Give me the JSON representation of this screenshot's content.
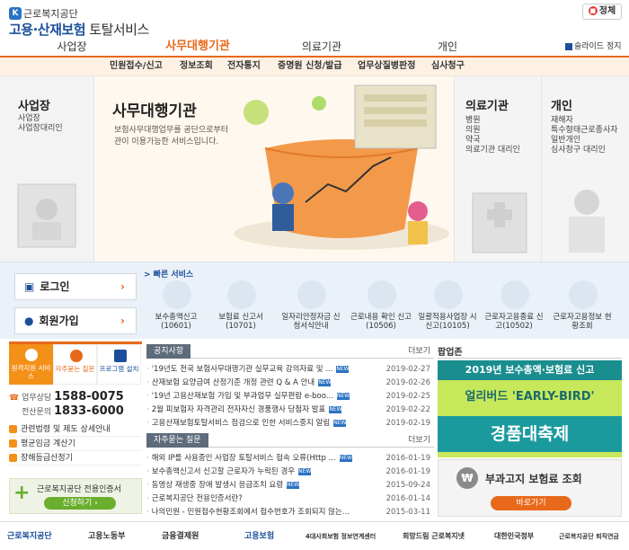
{
  "header": {
    "logo_mark": "K",
    "org_small": "근로복지공단",
    "title_main": "고용·산재보험",
    "title_sub": " 토탈서비스",
    "stop_label": "정체"
  },
  "nav": {
    "items": [
      "사업장",
      "사무대행기관",
      "의료기관",
      "개인"
    ],
    "active": "사무대행기관",
    "slide_stop": "슬라이드 정지"
  },
  "subnav": [
    "민원접수/신고",
    "정보조회",
    "전자통지",
    "증명원 신청/발급",
    "업무상질병판정",
    "심사청구"
  ],
  "hero": {
    "workplace": {
      "title": "사업장",
      "items": [
        "사업장",
        "사업장대리인"
      ]
    },
    "agency": {
      "title": "사무대행기관",
      "desc": "보험사무대행업무를 공단으로부터 승인 받은 기관이 이용가능한 서비스입니다."
    },
    "medical": {
      "title": "의료기관",
      "items": [
        "병원",
        "의원",
        "약국",
        "의료기관 대리인"
      ]
    },
    "personal": {
      "title": "개인",
      "items": [
        "재해자",
        "특수형태근로종사자",
        "일반개인",
        "심사청구 대리인"
      ]
    }
  },
  "side_buttons": {
    "login": "로그인",
    "join": "회원가입",
    "chevron": "›"
  },
  "quick": {
    "title": "> 빠른 서비스",
    "items": [
      {
        "label": "보수총액신고 (10601)"
      },
      {
        "label": "보험료 신고서 (10701)"
      },
      {
        "label": "일자리안정자금 신청서식안내"
      },
      {
        "label": "근로내용 확인 신고(10506)"
      },
      {
        "label": "일괄적용사업장 시신고(10105)"
      },
      {
        "label": "근로자고용종료 신고(10502)"
      },
      {
        "label": "근로자고용정보 현황조회"
      }
    ]
  },
  "contact": {
    "remote": "원격지원 서비스",
    "faq": "자주묻는 질문",
    "install": "프로그램 설치",
    "phone1_label": "업무상담",
    "phone1": "1588-0075",
    "phone2_label": "전산문의",
    "phone2": "1833-6000"
  },
  "left_links": [
    "관련법령 및 제도 상세안내",
    "평균임금 계산기",
    "장해등급산정기"
  ],
  "cert": {
    "plus": "+",
    "text": "근로복지공단 전용인증서",
    "button": "신청하기 ›"
  },
  "notices": {
    "tab": "공지사항",
    "more": "더보기",
    "new_badge": "NEW",
    "rows": [
      {
        "title": "'19년도 전국 보험사무대행기관 실무교육 강의자료 및 ...",
        "date": "2019-02-27"
      },
      {
        "title": "산재보험 요양급여 산정기준 개정 관련 Q & A 안내",
        "date": "2019-02-26"
      },
      {
        "title": "'19년 고용산재보험 가입 및 부과업무 실무편람 e-boo...",
        "date": "2019-02-25"
      },
      {
        "title": "2월 피보험자 자격관리 전자자신 경품행사 당첨자 발표",
        "date": "2019-02-22"
      },
      {
        "title": "고용산재보험토탈서비스 점검으로 인한 서비스중지 알림",
        "date": "2019-02-19"
      }
    ]
  },
  "faq": {
    "tab": "자주묻는 질문",
    "more": "더보기",
    "rows": [
      {
        "title": "해외 IP를 사용중인 사업장 토탈서비스 접속 오류(Http ...",
        "date": "2016-01-19"
      },
      {
        "title": "보수총액신고서 신고할 근로자가 누락된 경우",
        "date": "2016-01-19"
      },
      {
        "title": "동영상 재생중 장애 발생시 응급조치 요령",
        "date": "2015-09-24"
      },
      {
        "title": "근로복지공단 전용인증서란?",
        "date": "2016-01-14"
      },
      {
        "title": "나의민원 - 민원접수현황조회에서 접수번호가 조회되지 않는...",
        "date": "2015-03-11"
      }
    ]
  },
  "popup": {
    "title": "팝업존",
    "banner_line1": "2019년 보수총액·보험료 신고",
    "banner_line2": "얼리버드 'EARLY-BIRD'",
    "banner_line3": "경품대축제",
    "surcharge_icon": "₩",
    "surcharge_text": "부과고지 보험료 조회",
    "surcharge_btn": "바로가기"
  },
  "footer": [
    "근로복지공단",
    "고용노동부",
    "금융결제원",
    "고용보험",
    "4대사회보험 정보연계센터",
    "희망드림 근로복지넷",
    "대한민국정부",
    "근로복지공단 퇴직연금"
  ],
  "colors": {
    "accent": "#e8691a",
    "brand": "#1b4f9a",
    "green": "#6aae2e",
    "teal": "#1a9a9d"
  }
}
